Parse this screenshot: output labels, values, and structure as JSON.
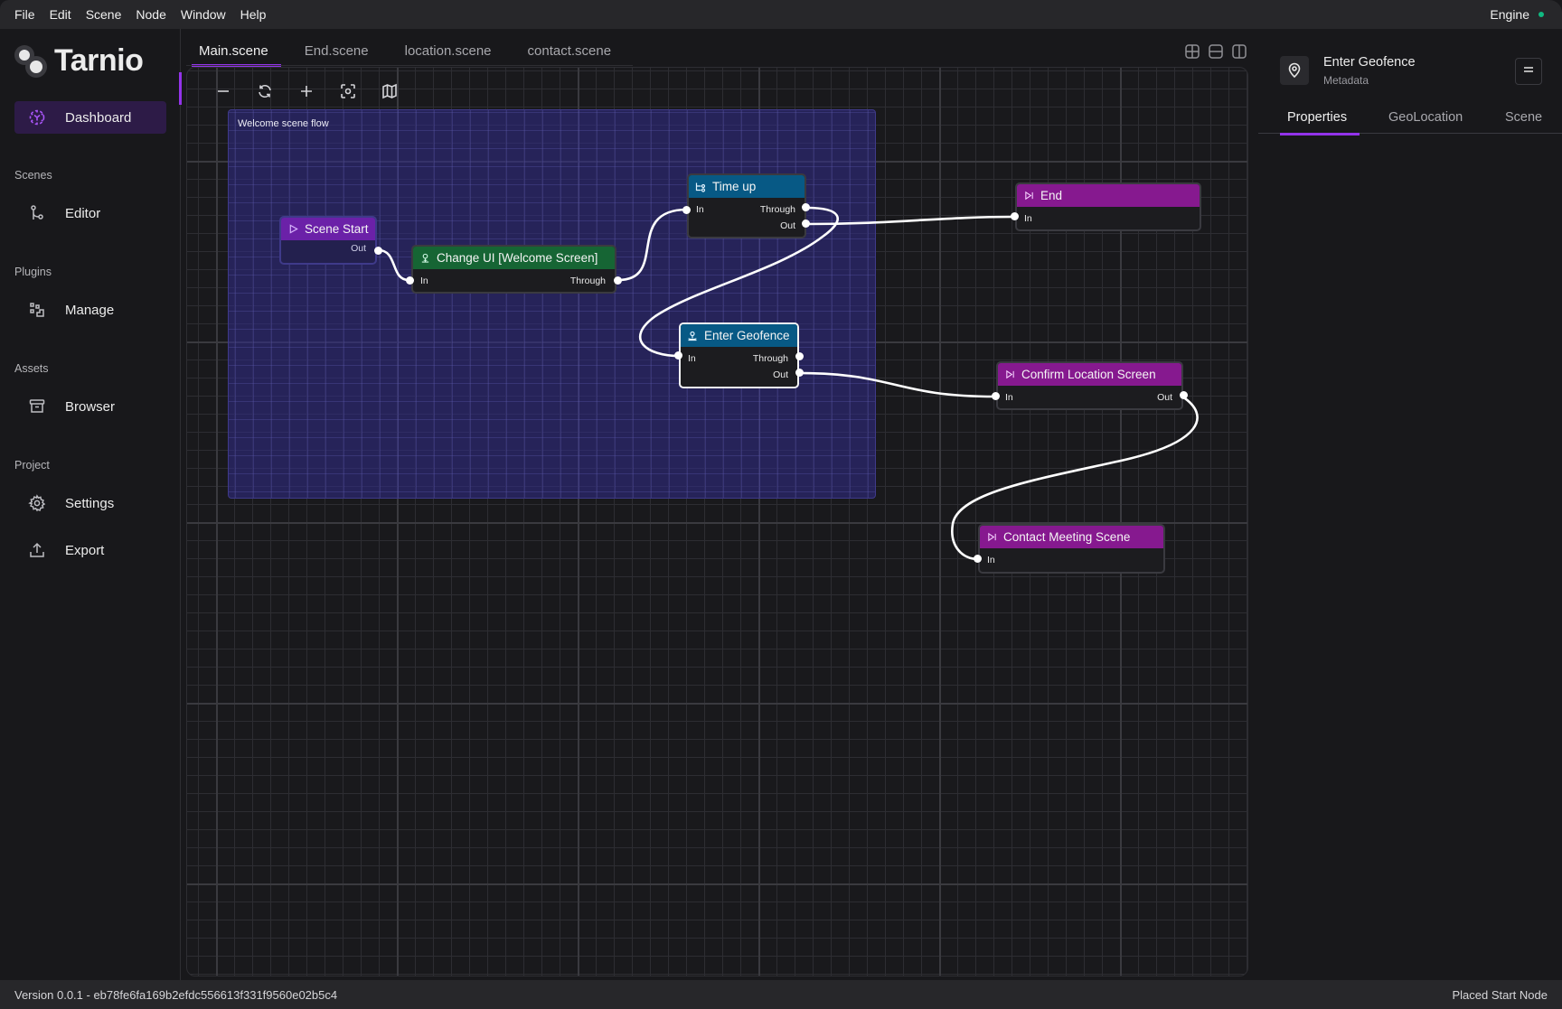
{
  "menubar": {
    "items": [
      "File",
      "Edit",
      "Scene",
      "Node",
      "Window",
      "Help"
    ],
    "engine_label": "Engine",
    "engine_status_color": "#10b981"
  },
  "sidebar": {
    "logo_text": "Tarnio",
    "active_item": {
      "label": "Dashboard",
      "icon": "dashboard-icon"
    },
    "sections": [
      {
        "title": "Scenes",
        "items": [
          {
            "label": "Editor",
            "icon": "git-branch-icon"
          }
        ]
      },
      {
        "title": "Plugins",
        "items": [
          {
            "label": "Manage",
            "icon": "plugin-blocks-icon"
          }
        ]
      },
      {
        "title": "Assets",
        "items": [
          {
            "label": "Browser",
            "icon": "archive-box-icon"
          }
        ]
      },
      {
        "title": "Project",
        "items": [
          {
            "label": "Settings",
            "icon": "gear-icon"
          },
          {
            "label": "Export",
            "icon": "upload-icon"
          }
        ]
      }
    ],
    "accent_color": "#9333ea"
  },
  "editor": {
    "tabs": [
      {
        "label": "Main.scene",
        "active": true
      },
      {
        "label": "End.scene",
        "active": false
      },
      {
        "label": "location.scene",
        "active": false
      },
      {
        "label": "contact.scene",
        "active": false
      }
    ],
    "layout_buttons": [
      "grid-quad-icon",
      "split-horizontal-icon",
      "split-vertical-icon"
    ],
    "toolbar": [
      "zoom-out-icon",
      "refresh-icon",
      "zoom-in-icon",
      "focus-icon",
      "map-icon"
    ],
    "group": {
      "label": "Welcome scene flow"
    },
    "nodes": {
      "scene_start": {
        "title": "Scene Start",
        "icon": "play-icon",
        "outputs": [
          "Out"
        ]
      },
      "change_ui": {
        "title": "Change UI [Welcome Screen]",
        "icon": "ui-person-icon",
        "inputs": [
          "In"
        ],
        "outputs": [
          "Through"
        ]
      },
      "time_up": {
        "title": "Time up",
        "icon": "timer-branch-icon",
        "inputs": [
          "In"
        ],
        "outputs": [
          "Through",
          "Out"
        ]
      },
      "enter_geofence": {
        "title": "Enter Geofence",
        "icon": "geofence-pin-icon",
        "inputs": [
          "In"
        ],
        "outputs": [
          "Through",
          "Out"
        ],
        "selected": true
      },
      "end": {
        "title": "End",
        "icon": "skip-forward-icon",
        "inputs": [
          "In"
        ]
      },
      "confirm_location": {
        "title": "Confirm Location Screen",
        "icon": "skip-forward-icon",
        "inputs": [
          "In"
        ],
        "outputs": [
          "Out"
        ]
      },
      "contact_meeting": {
        "title": "Contact Meeting Scene",
        "icon": "skip-forward-icon",
        "inputs": [
          "In"
        ]
      }
    },
    "connections": [
      {
        "from": "scene_start.Out",
        "to": "change_ui.In"
      },
      {
        "from": "change_ui.Through",
        "to": "time_up.In"
      },
      {
        "from": "time_up.Through",
        "to": "enter_geofence.In"
      },
      {
        "from": "time_up.Out",
        "to": "end.In"
      },
      {
        "from": "enter_geofence.Out",
        "to": "confirm_location.In"
      },
      {
        "from": "confirm_location.Out",
        "to": "contact_meeting.In"
      }
    ]
  },
  "inspector": {
    "title": "Enter Geofence",
    "subtitle": "Metadata",
    "icon": "map-pin-icon",
    "tabs": [
      {
        "label": "Properties",
        "active": true
      },
      {
        "label": "GeoLocation",
        "active": false
      },
      {
        "label": "Scene",
        "active": false
      }
    ]
  },
  "statusbar": {
    "version": "Version 0.0.1 - eb78fe6fa169b2efdc556613f331f9560e02b5c4",
    "message": "Placed Start Node"
  }
}
